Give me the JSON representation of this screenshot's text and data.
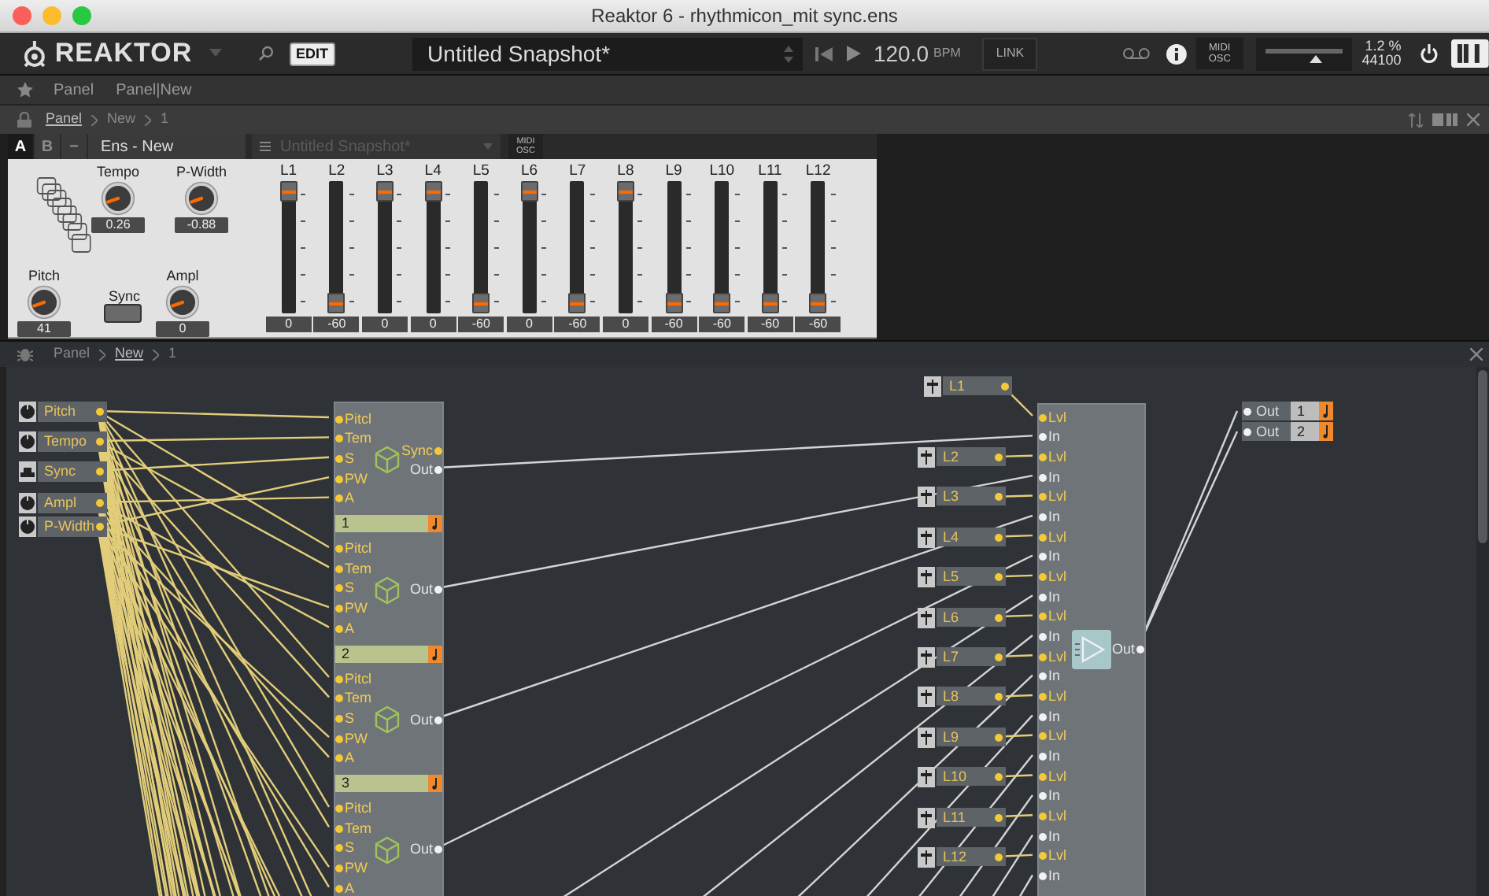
{
  "window": {
    "title": "Reaktor 6 - rhythmicon_mit sync.ens"
  },
  "toolbar": {
    "app_name": "REAKTOR",
    "edit": "EDIT",
    "snapshot": "Untitled Snapshot*",
    "tempo": "120.0",
    "tempo_unit": "BPM",
    "link": "LINK",
    "midi": "MIDI",
    "osc": "OSC",
    "volume": {
      "level": 0.66
    },
    "cpu": "1.2 %",
    "sample_rate": "44100"
  },
  "favorites": [
    "Panel",
    "Panel|New"
  ],
  "panel_breadcrumb": [
    {
      "label": "Panel",
      "selected": true
    },
    {
      "label": "New",
      "selected": false
    },
    {
      "label": "1",
      "selected": false
    }
  ],
  "instrument_header": {
    "tabs": [
      {
        "label": "A",
        "selected": true
      },
      {
        "label": "B",
        "selected": false
      }
    ],
    "minus": "−",
    "name": "Ens - New",
    "snapshot": {
      "label": "Untitled Snapshot*",
      "disabled": true
    },
    "midi": "MIDI",
    "osc": "OSC"
  },
  "panel": {
    "knobs": [
      {
        "label": "Tempo",
        "value": "0.26"
      },
      {
        "label": "P-Width",
        "value": "-0.88"
      },
      {
        "label": "Pitch",
        "value": "41"
      },
      {
        "label": "Ampl",
        "value": "0"
      }
    ],
    "sync_button": {
      "label": "Sync",
      "on": false
    },
    "faders": [
      {
        "label": "L1",
        "level": 1,
        "reading": "0"
      },
      {
        "label": "L2",
        "level": 0,
        "reading": "-60"
      },
      {
        "label": "L3",
        "level": 1,
        "reading": "0"
      },
      {
        "label": "L4",
        "level": 1,
        "reading": "0"
      },
      {
        "label": "L5",
        "level": 0,
        "reading": "-60"
      },
      {
        "label": "L6",
        "level": 1,
        "reading": "0"
      },
      {
        "label": "L7",
        "level": 0,
        "reading": "-60"
      },
      {
        "label": "L8",
        "level": 1,
        "reading": "0"
      },
      {
        "label": "L9",
        "level": 0,
        "reading": "-60"
      },
      {
        "label": "L10",
        "level": 0,
        "reading": "-60"
      },
      {
        "label": "L11",
        "level": 0,
        "reading": "-60"
      },
      {
        "label": "L12",
        "level": 0,
        "reading": "-60"
      }
    ]
  },
  "structure_breadcrumb": [
    {
      "label": "Panel",
      "selected": false
    },
    {
      "label": "New",
      "selected": true
    },
    {
      "label": "1",
      "selected": false
    }
  ],
  "structure": {
    "controls": [
      {
        "label": "Pitch",
        "kind": "knob"
      },
      {
        "label": "Tempo",
        "kind": "knob"
      },
      {
        "label": "Sync",
        "kind": "button"
      },
      {
        "label": "Ampl",
        "kind": "knob"
      },
      {
        "label": "P-Width",
        "kind": "knob"
      }
    ],
    "oscillator_sections": [
      {
        "inputs": [
          "Pitcl",
          "Tem",
          "S",
          "PW",
          "A"
        ],
        "outputs": [
          {
            "label": "Sync",
            "kind": "event"
          },
          {
            "label": "Out",
            "kind": "audio"
          }
        ],
        "voice": "1"
      },
      {
        "inputs": [
          "Pitcl",
          "Tem",
          "S",
          "PW",
          "A"
        ],
        "outputs": [
          {
            "label": "Out",
            "kind": "audio"
          }
        ],
        "voice": "2"
      },
      {
        "inputs": [
          "Pitcl",
          "Tem",
          "S",
          "PW",
          "A"
        ],
        "outputs": [
          {
            "label": "Out",
            "kind": "audio"
          }
        ],
        "voice": "3"
      },
      {
        "inputs": [
          "Pitcl",
          "Tem",
          "S",
          "PW",
          "A"
        ],
        "outputs": [
          {
            "label": "Out",
            "kind": "audio"
          }
        ]
      }
    ],
    "level_controls": [
      "L1",
      "L2",
      "L3",
      "L4",
      "L5",
      "L6",
      "L7",
      "L8",
      "L9",
      "L10",
      "L11",
      "L12"
    ],
    "mixer": {
      "inputs": [
        {
          "label": "Lvl",
          "kind": "event"
        },
        {
          "label": "In",
          "kind": "audio"
        },
        {
          "label": "Lvl",
          "kind": "event"
        },
        {
          "label": "In",
          "kind": "audio"
        },
        {
          "label": "Lvl",
          "kind": "event"
        },
        {
          "label": "In",
          "kind": "audio"
        },
        {
          "label": "Lvl",
          "kind": "event"
        },
        {
          "label": "In",
          "kind": "audio"
        },
        {
          "label": "Lvl",
          "kind": "event"
        },
        {
          "label": "In",
          "kind": "audio"
        },
        {
          "label": "Lvl",
          "kind": "event"
        },
        {
          "label": "In",
          "kind": "audio"
        },
        {
          "label": "Lvl",
          "kind": "event"
        },
        {
          "label": "In",
          "kind": "audio"
        },
        {
          "label": "Lvl",
          "kind": "event"
        },
        {
          "label": "In",
          "kind": "audio"
        },
        {
          "label": "Lvl",
          "kind": "event"
        },
        {
          "label": "In",
          "kind": "audio"
        },
        {
          "label": "Lvl",
          "kind": "event"
        },
        {
          "label": "In",
          "kind": "audio"
        },
        {
          "label": "Lvl",
          "kind": "event"
        },
        {
          "label": "In",
          "kind": "audio"
        },
        {
          "label": "Lvl",
          "kind": "event"
        },
        {
          "label": "In",
          "kind": "audio"
        }
      ],
      "output": "Out"
    },
    "outputs": [
      {
        "label": "Out",
        "channel": "1"
      },
      {
        "label": "Out",
        "channel": "2"
      }
    ]
  }
}
